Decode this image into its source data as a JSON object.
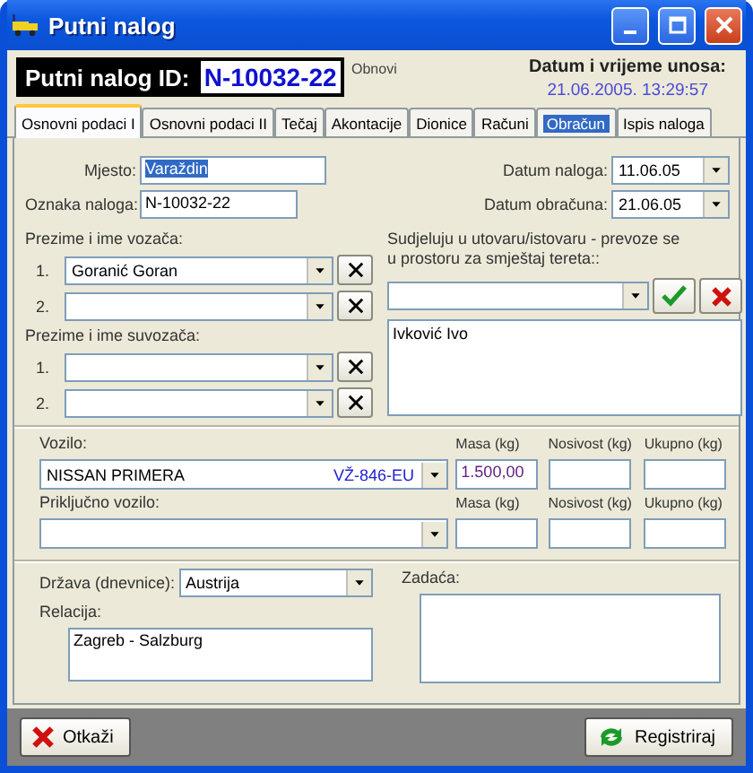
{
  "window": {
    "title": "Putni nalog"
  },
  "header": {
    "id_label": "Putni nalog ID:",
    "id_value": "N-10032-22",
    "refresh_link": "Obnovi",
    "datetime_label": "Datum i vrijeme unosa:",
    "datetime_value": "21.06.2005. 13:29:57"
  },
  "tabs": [
    {
      "label": "Osnovni podaci I",
      "selected": true,
      "highlighted": false
    },
    {
      "label": "Osnovni podaci II",
      "selected": false,
      "highlighted": false
    },
    {
      "label": "Tečaj",
      "selected": false,
      "highlighted": false
    },
    {
      "label": "Akontacije",
      "selected": false,
      "highlighted": false
    },
    {
      "label": "Dionice",
      "selected": false,
      "highlighted": false
    },
    {
      "label": "Računi",
      "selected": false,
      "highlighted": false
    },
    {
      "label": "Obračun",
      "selected": false,
      "highlighted": true
    },
    {
      "label": "Ispis naloga",
      "selected": false,
      "highlighted": false
    }
  ],
  "general": {
    "place": {
      "label": "Mjesto:",
      "value": "Varaždin",
      "text_selected": true
    },
    "order_mark": {
      "label": "Oznaka naloga:",
      "value": "N-10032-22"
    },
    "order_date": {
      "label": "Datum naloga:",
      "value": "11.06.05"
    },
    "settlement_date": {
      "label": "Datum obračuna:",
      "value": "21.06.05"
    }
  },
  "drivers": {
    "label": "Prezime i ime vozača:",
    "rows": [
      {
        "number": "1.",
        "value": "Goranić Goran"
      },
      {
        "number": "2."
      }
    ]
  },
  "co_drivers": {
    "label": "Prezime i ime suvozača:",
    "rows": [
      {
        "number": "1."
      },
      {
        "number": "2."
      }
    ]
  },
  "loading": {
    "label_lines": [
      "Sudjeluju u utovaru/istovaru - prevoze se",
      "u prostoru za smještaj tereta::"
    ],
    "list": [
      "Ivković Ivo"
    ]
  },
  "vehicle": {
    "label": "Vozilo:",
    "value": "NISSAN PRIMERA",
    "plate": "VŽ-846-EU",
    "mass_label": "Masa (kg)",
    "mass": "1.500,00",
    "capacity_label": "Nosivost (kg)",
    "total_label": "Ukupno (kg)"
  },
  "trailer": {
    "label": "Priključno vozilo:",
    "mass_label": "Masa (kg)",
    "capacity_label": "Nosivost (kg)",
    "total_label": "Ukupno (kg)"
  },
  "country": {
    "label": "Država (dnevnice):",
    "value": "Austrija"
  },
  "relation": {
    "label": "Relacija:",
    "value": "Zagreb - Salzburg"
  },
  "task": {
    "label": "Zadaća:"
  },
  "buttons": [
    {
      "label": "Otkaži",
      "kind": "cancel"
    },
    {
      "label": "Registriraj",
      "kind": "register"
    }
  ]
}
